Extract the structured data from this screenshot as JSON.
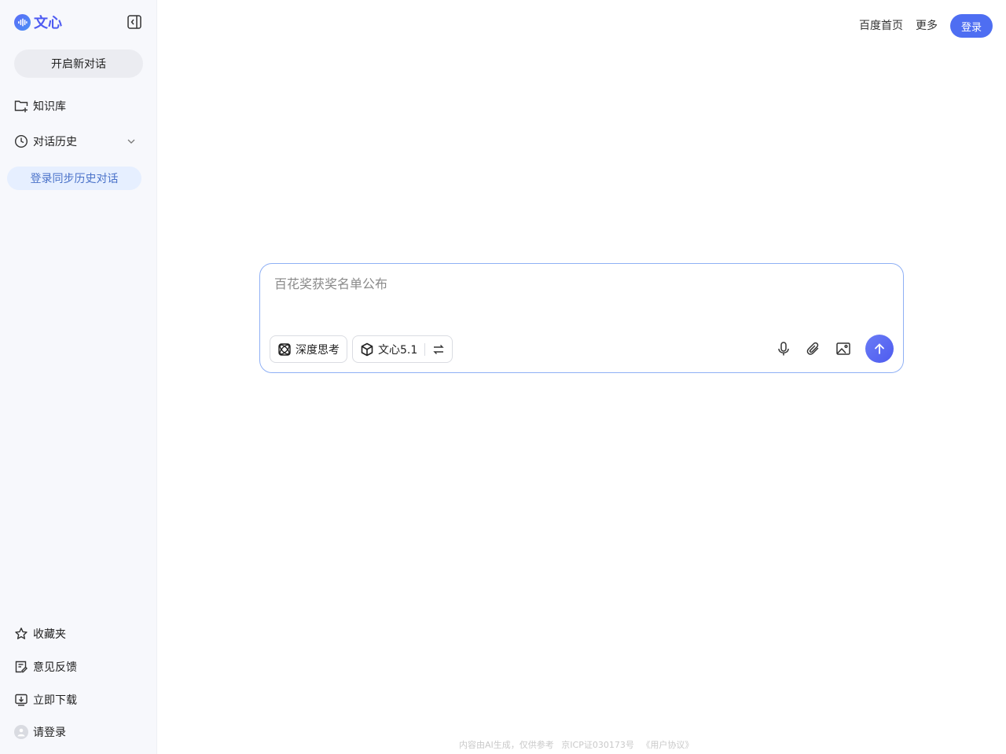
{
  "brand": {
    "name": "文心",
    "logo_icon": "wenxin-logo-icon"
  },
  "sidebar": {
    "new_chat_label": "开启新对话",
    "items": [
      {
        "label": "知识库",
        "icon": "folder-plus-icon"
      },
      {
        "label": "对话历史",
        "icon": "clock-icon"
      }
    ],
    "sync_label": "登录同步历史对话",
    "bottom_items": [
      {
        "label": "收藏夹",
        "icon": "star-icon"
      },
      {
        "label": "意见反馈",
        "icon": "feedback-icon"
      },
      {
        "label": "立即下载",
        "icon": "download-icon"
      },
      {
        "label": "请登录",
        "icon": "avatar-icon"
      }
    ]
  },
  "topnav": {
    "home_label": "百度首页",
    "more_label": "更多",
    "login_label": "登录"
  },
  "composer": {
    "placeholder": "百花奖获奖名单公布",
    "deep_think_label": "深度思考",
    "model_label": "文心5.1"
  },
  "footer": {
    "disclaimer": "内容由AI生成，仅供参考",
    "icp": "京ICP证030173号",
    "agreement": "《用户协议》"
  },
  "colors": {
    "accent": "#4e6ef2",
    "sidebar_bg": "#f7f8fc",
    "sync_bg": "#e6efff"
  }
}
